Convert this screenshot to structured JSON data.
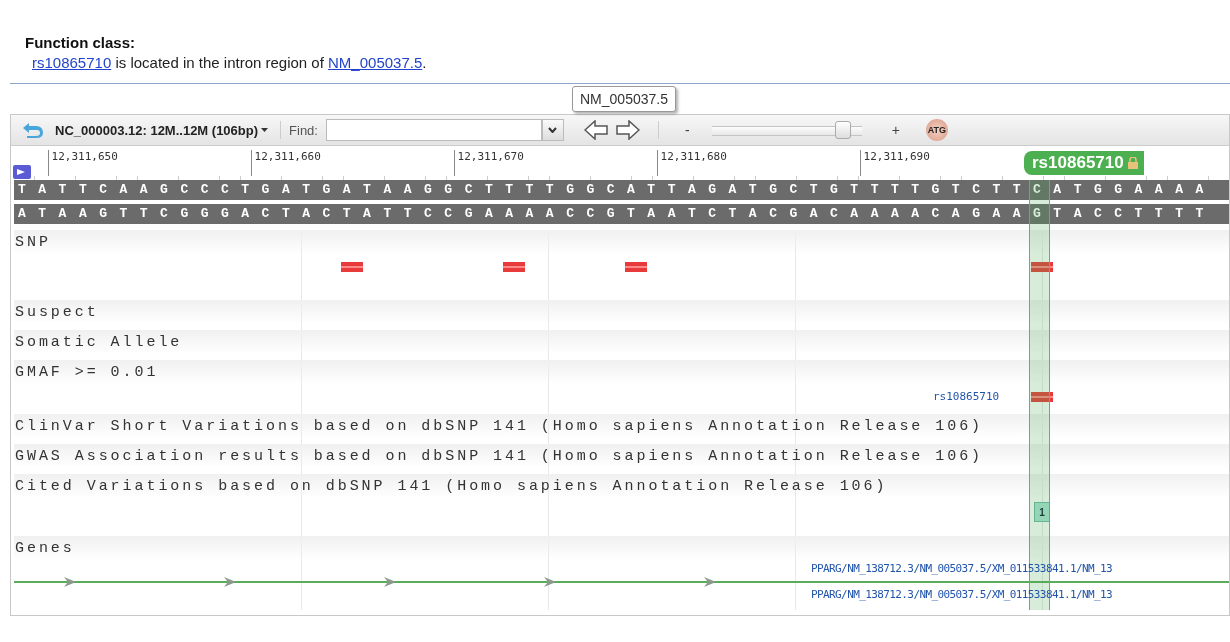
{
  "function_class": {
    "heading": "Function class:",
    "sentence": [
      {
        "kind": "link",
        "text": "rs10865710"
      },
      {
        "kind": "text",
        "text": " is located in the intron region of "
      },
      {
        "kind": "link",
        "text": "NM_005037.5"
      },
      {
        "kind": "text",
        "text": "."
      }
    ]
  },
  "tooltip": "NM_005037.5",
  "toolbar": {
    "sequence_label": "NC_000003.12: 12M..12M (106bp)",
    "find_label": "Find:",
    "zoom_out": "-",
    "zoom_in": "+",
    "zoom": {
      "level": 0.87
    },
    "sequence_button": "ATG"
  },
  "ruler": {
    "ticks": [
      "12,311,650",
      "12,311,660",
      "12,311,670",
      "12,311,680",
      "12,311,690"
    ],
    "marker": "rs10865710"
  },
  "sequence": {
    "forward": "TATTCAAGCCCTGATGATAAGGCTTTTGGCATTAGATGCTGTTTTGTCTTCATGGAAAA",
    "reverse": "ATAAGTTCGGGACTACTATTCCGAAAACCGTAATCTACGACAAAACAGAAGTACCTTTT"
  },
  "tracks": [
    {
      "label": "SNP",
      "features": [
        {
          "kind": "variant"
        },
        {
          "kind": "variant"
        },
        {
          "kind": "variant"
        },
        {
          "kind": "variant"
        }
      ]
    },
    {
      "label": "Suspect"
    },
    {
      "label": "Somatic Allele"
    },
    {
      "label": "GMAF >= 0.01",
      "features": [
        {
          "kind": "variant",
          "name": "rs10865710"
        }
      ]
    },
    {
      "label": "ClinVar Short Variations based on dbSNP 141 (Homo sapiens Annotation Release 106)"
    },
    {
      "label": "GWAS Association results based on dbSNP 141 (Homo sapiens Annotation Release 106)"
    },
    {
      "label": "Cited Variations based on dbSNP 141 (Homo sapiens Annotation Release 106)",
      "features": [
        {
          "kind": "count",
          "count": "1"
        }
      ]
    },
    {
      "label": "Genes",
      "features": [
        {
          "kind": "gene",
          "names": [
            "PPARG/NM_138712.3/NM_005037.5/XM_011533841.1/NM_13",
            "PPARG/NM_138712.3/NM_005037.5/XM_011533841.1/NM_13"
          ]
        }
      ]
    }
  ]
}
